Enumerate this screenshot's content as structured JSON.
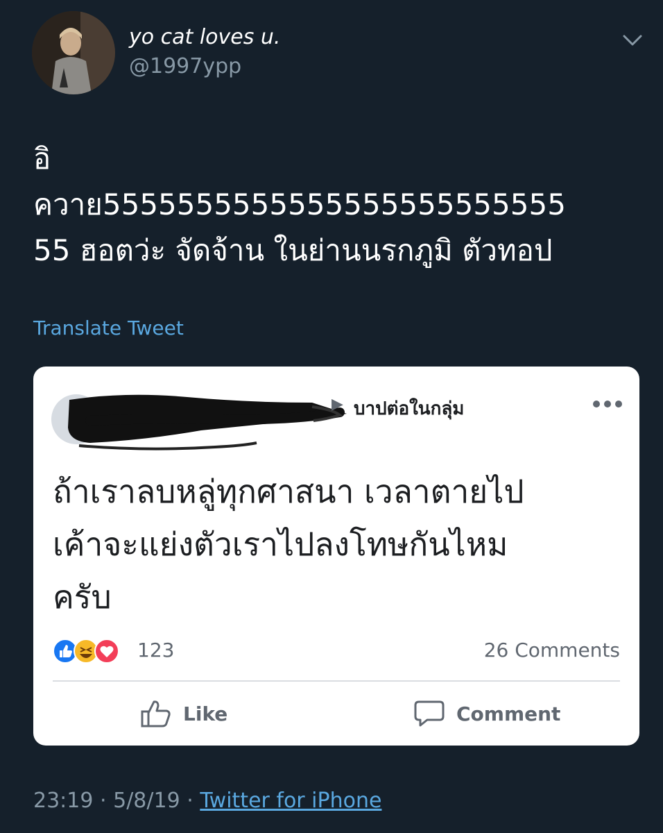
{
  "tweet": {
    "author": {
      "display_name": "yo cat loves u.",
      "handle": "@1997ypp"
    },
    "text_lines": [
      "อิ",
      "ควาย5555555555555555555555555",
      "55 ฮอตว่ะ จัดจ้าน ในย่านนรกภูมิ ตัวทอป"
    ],
    "translate_label": "Translate Tweet",
    "footer": {
      "time": "23:19",
      "separator": "·",
      "date": "5/8/19",
      "source": "Twitter for iPhone"
    }
  },
  "embedded_post": {
    "shared_to": "บาปต่อในกลุ่ม",
    "text_lines": [
      "ถ้าเราลบหลู่ทุกศาสนา เวลาตายไป",
      "เค้าจะแย่งตัวเราไปลงโทษกันไหม",
      "ครับ"
    ],
    "reaction_count": "123",
    "reactions": [
      "like-icon",
      "haha-icon",
      "love-icon"
    ],
    "comments_count": "26 Comments",
    "actions": {
      "like_label": "Like",
      "comment_label": "Comment"
    }
  },
  "colors": {
    "background": "#15202b",
    "link": "#5aa8e0",
    "secondary_text": "#8899a6",
    "card_background": "#ffffff",
    "like_blue": "#1877f2",
    "love_red": "#f33e58",
    "haha_yellow": "#f7b928"
  }
}
